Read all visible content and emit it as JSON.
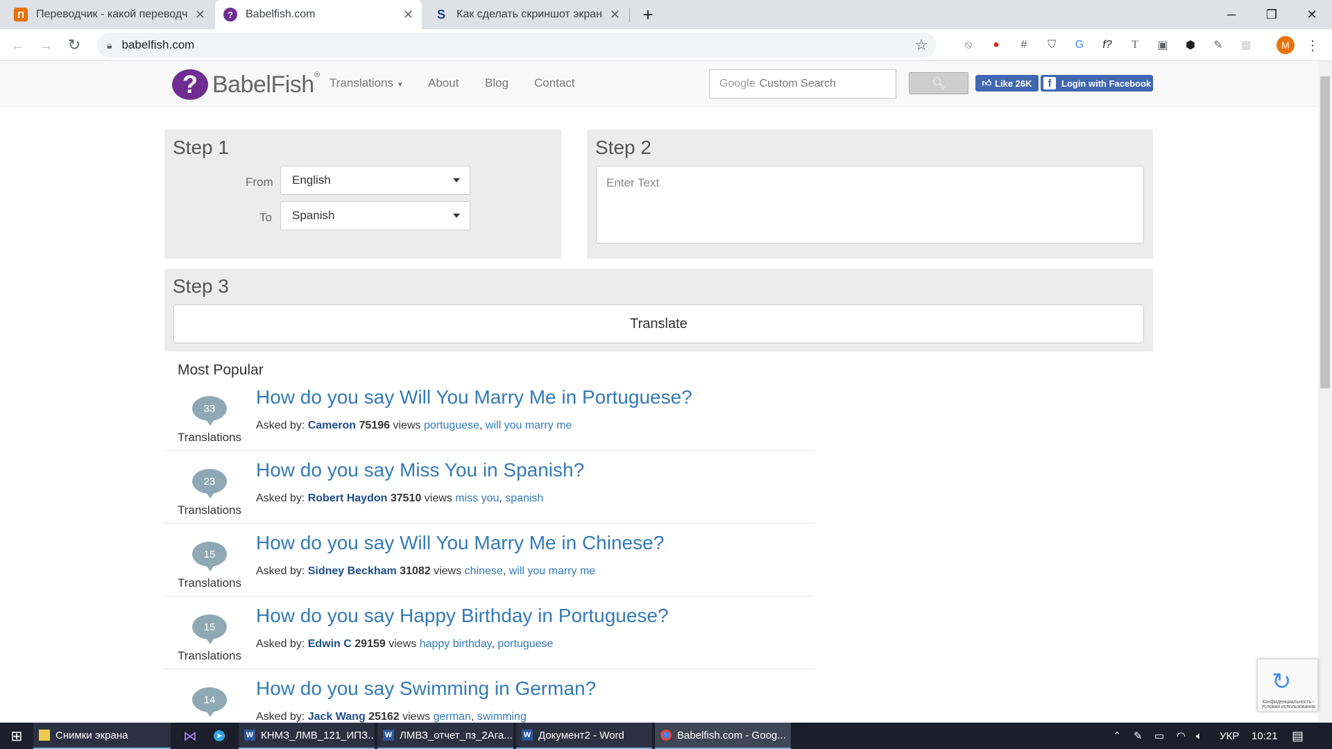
{
  "browser": {
    "tabs": [
      {
        "title": "Переводчик - какой переводчик",
        "favicon": "П",
        "favicon_color": "#e8710a",
        "active": false
      },
      {
        "title": "Babelfish.com",
        "favicon": "?",
        "favicon_color": "#6f2c91",
        "active": true
      },
      {
        "title": "Как сделать скриншот экрана на",
        "favicon": "S",
        "favicon_color": "#1a3f8f",
        "active": false
      }
    ],
    "new_tab": "+",
    "url": "babelfish.com",
    "profile_initial": "M"
  },
  "site": {
    "logo_text": "BabelFish",
    "logo_mark": "?",
    "logo_reg": "®",
    "nav": {
      "translations": "Translations",
      "about": "About",
      "blog": "Blog",
      "contact": "Contact"
    },
    "search": {
      "brand": "Google",
      "placeholder": "Custom Search"
    },
    "fb_like": "Like 26K",
    "fb_login": "Login with Facebook"
  },
  "step1": {
    "title": "Step 1",
    "from_label": "From",
    "from_value": "English",
    "to_label": "To",
    "to_value": "Spanish"
  },
  "step2": {
    "title": "Step 2",
    "placeholder": "Enter Text"
  },
  "step3": {
    "title": "Step 3",
    "button": "Translate"
  },
  "popular": {
    "heading": "Most Popular",
    "translations_label": "Translations",
    "asked_by_label": "Asked by:",
    "views_label": "views",
    "items": [
      {
        "count": "33",
        "title": "How do you say Will You Marry Me in Portuguese?",
        "author": "Cameron",
        "views": "75196",
        "tags": [
          "portuguese",
          "will you marry me"
        ]
      },
      {
        "count": "23",
        "title": "How do you say Miss You in Spanish?",
        "author": "Robert Haydon",
        "views": "37510",
        "tags": [
          "miss you",
          "spanish"
        ]
      },
      {
        "count": "15",
        "title": "How do you say Will You Marry Me in Chinese?",
        "author": "Sidney Beckham",
        "views": "31082",
        "tags": [
          "chinese",
          "will you marry me"
        ]
      },
      {
        "count": "15",
        "title": "How do you say Happy Birthday in Portuguese?",
        "author": "Edwin C",
        "views": "29159",
        "tags": [
          "happy birthday",
          "portuguese"
        ]
      },
      {
        "count": "14",
        "title": "How do you say Swimming in German?",
        "author": "Jack Wang",
        "views": "25162",
        "tags": [
          "german",
          "swimming"
        ]
      }
    ]
  },
  "recaptcha": {
    "text": "Конфиденциальность - Условия использования"
  },
  "taskbar": {
    "items": [
      {
        "label": "Снимки экрана",
        "icon": "folder-icon"
      },
      {
        "label": "КНМЗ_ЛМВ_121_ИПЗ...",
        "icon": "word-icon"
      },
      {
        "label": "ЛМВЗ_отчет_пз_2Ага...",
        "icon": "word-icon"
      },
      {
        "label": "Документ2 - Word",
        "icon": "word-icon"
      },
      {
        "label": "Babelfish.com - Goog...",
        "icon": "chrome-icon"
      }
    ],
    "lang": "УКР",
    "time": "10:21"
  }
}
